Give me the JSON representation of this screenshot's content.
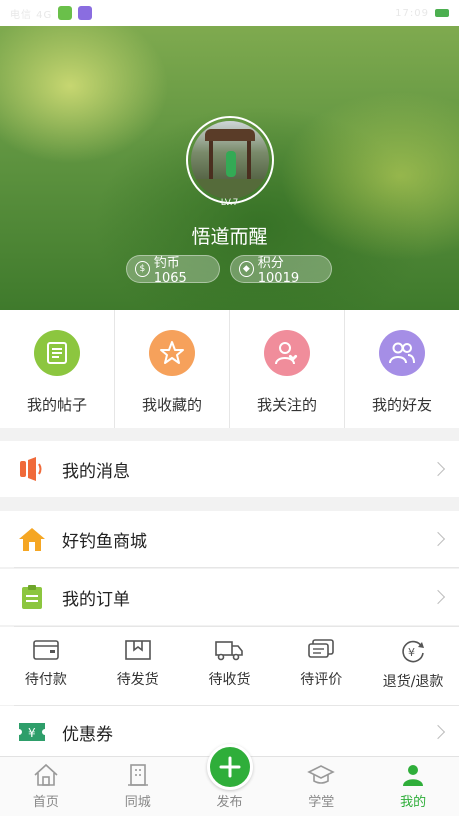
{
  "status_bar": {
    "left_text": "电信 4G",
    "right_text": "17:09"
  },
  "profile": {
    "level": "LV.7",
    "username": "悟道而醒",
    "coins_label": "钓币 1065",
    "points_label": "积分 10019"
  },
  "quick": [
    {
      "label": "我的帖子",
      "icon": "document-icon",
      "color": "#8cc63f"
    },
    {
      "label": "我收藏的",
      "icon": "star-icon",
      "color": "#f6a15b"
    },
    {
      "label": "我关注的",
      "icon": "person-heart-icon",
      "color": "#f08d9b"
    },
    {
      "label": "我的好友",
      "icon": "friends-icon",
      "color": "#a58ee6"
    }
  ],
  "rows": {
    "messages": "我的消息",
    "mall": "好钓鱼商城",
    "orders": "我的订单",
    "coupons": "优惠券"
  },
  "order_status": [
    {
      "label": "待付款",
      "icon": "wallet-icon"
    },
    {
      "label": "待发货",
      "icon": "package-icon"
    },
    {
      "label": "待收货",
      "icon": "truck-icon"
    },
    {
      "label": "待评价",
      "icon": "comment-icon"
    },
    {
      "label": "退货/退款",
      "icon": "refund-icon"
    }
  ],
  "nav": {
    "home": "首页",
    "city": "同城",
    "publish": "发布",
    "school": "学堂",
    "mine": "我的"
  },
  "colors": {
    "accent": "#2fae3a",
    "message_icon": "#f06a3a",
    "mall_icon": "#f5a623",
    "orders_icon": "#8cc63f",
    "coupon_icon": "#2e9e6a"
  }
}
